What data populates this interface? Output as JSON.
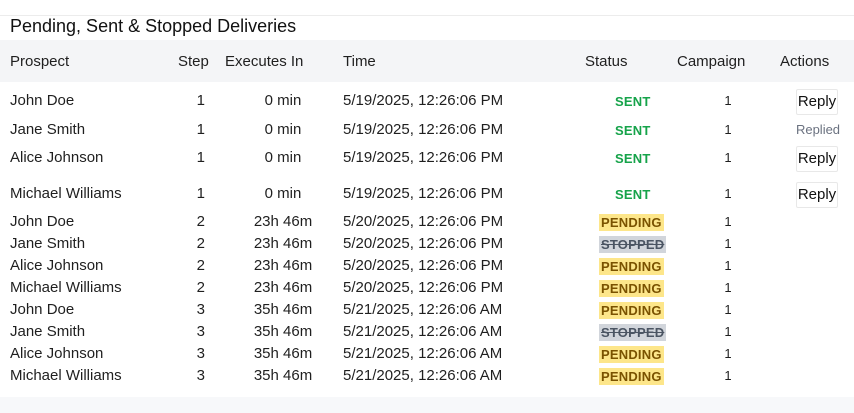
{
  "title": "Pending, Sent & Stopped Deliveries",
  "columns": {
    "prospect": "Prospect",
    "step": "Step",
    "executes_in": "Executes In",
    "time": "Time",
    "status": "Status",
    "campaign": "Campaign",
    "actions": "Actions"
  },
  "rows": [
    {
      "prospect": "John Doe",
      "step": "1",
      "executes_in": "0 min",
      "time": "5/19/2025, 12:26:06 PM",
      "status": "SENT",
      "status_type": "sent",
      "campaign": "1",
      "action": "Reply",
      "action_type": "reply"
    },
    {
      "prospect": "Jane Smith",
      "step": "1",
      "executes_in": "0 min",
      "time": "5/19/2025, 12:26:06 PM",
      "status": "SENT",
      "status_type": "sent",
      "campaign": "1",
      "action": "Replied",
      "action_type": "replied"
    },
    {
      "prospect": "Alice Johnson",
      "step": "1",
      "executes_in": "0 min",
      "time": "5/19/2025, 12:26:06 PM",
      "status": "SENT",
      "status_type": "sent",
      "campaign": "1",
      "action": "Reply",
      "action_type": "reply"
    },
    {
      "prospect": "Michael Williams",
      "step": "1",
      "executes_in": "0 min",
      "time": "5/19/2025, 12:26:06 PM",
      "status": "SENT",
      "status_type": "sent",
      "campaign": "1",
      "action": "Reply",
      "action_type": "reply"
    },
    {
      "prospect": "John Doe",
      "step": "2",
      "executes_in": "23h 46m",
      "time": "5/20/2025, 12:26:06 PM",
      "status": "PENDING",
      "status_type": "pending",
      "campaign": "1",
      "action": "",
      "action_type": "none"
    },
    {
      "prospect": "Jane Smith",
      "step": "2",
      "executes_in": "23h 46m",
      "time": "5/20/2025, 12:26:06 PM",
      "status": "STOPPED",
      "status_type": "stopped",
      "campaign": "1",
      "action": "",
      "action_type": "none"
    },
    {
      "prospect": "Alice Johnson",
      "step": "2",
      "executes_in": "23h 46m",
      "time": "5/20/2025, 12:26:06 PM",
      "status": "PENDING",
      "status_type": "pending",
      "campaign": "1",
      "action": "",
      "action_type": "none"
    },
    {
      "prospect": "Michael Williams",
      "step": "2",
      "executes_in": "23h 46m",
      "time": "5/20/2025, 12:26:06 PM",
      "status": "PENDING",
      "status_type": "pending",
      "campaign": "1",
      "action": "",
      "action_type": "none"
    },
    {
      "prospect": "John Doe",
      "step": "3",
      "executes_in": "35h 46m",
      "time": "5/21/2025, 12:26:06 AM",
      "status": "PENDING",
      "status_type": "pending",
      "campaign": "1",
      "action": "",
      "action_type": "none"
    },
    {
      "prospect": "Jane Smith",
      "step": "3",
      "executes_in": "35h 46m",
      "time": "5/21/2025, 12:26:06 AM",
      "status": "STOPPED",
      "status_type": "stopped",
      "campaign": "1",
      "action": "",
      "action_type": "none"
    },
    {
      "prospect": "Alice Johnson",
      "step": "3",
      "executes_in": "35h 46m",
      "time": "5/21/2025, 12:26:06 AM",
      "status": "PENDING",
      "status_type": "pending",
      "campaign": "1",
      "action": "",
      "action_type": "none"
    },
    {
      "prospect": "Michael Williams",
      "step": "3",
      "executes_in": "35h 46m",
      "time": "5/21/2025, 12:26:06 AM",
      "status": "PENDING",
      "status_type": "pending",
      "campaign": "1",
      "action": "",
      "action_type": "none"
    }
  ]
}
